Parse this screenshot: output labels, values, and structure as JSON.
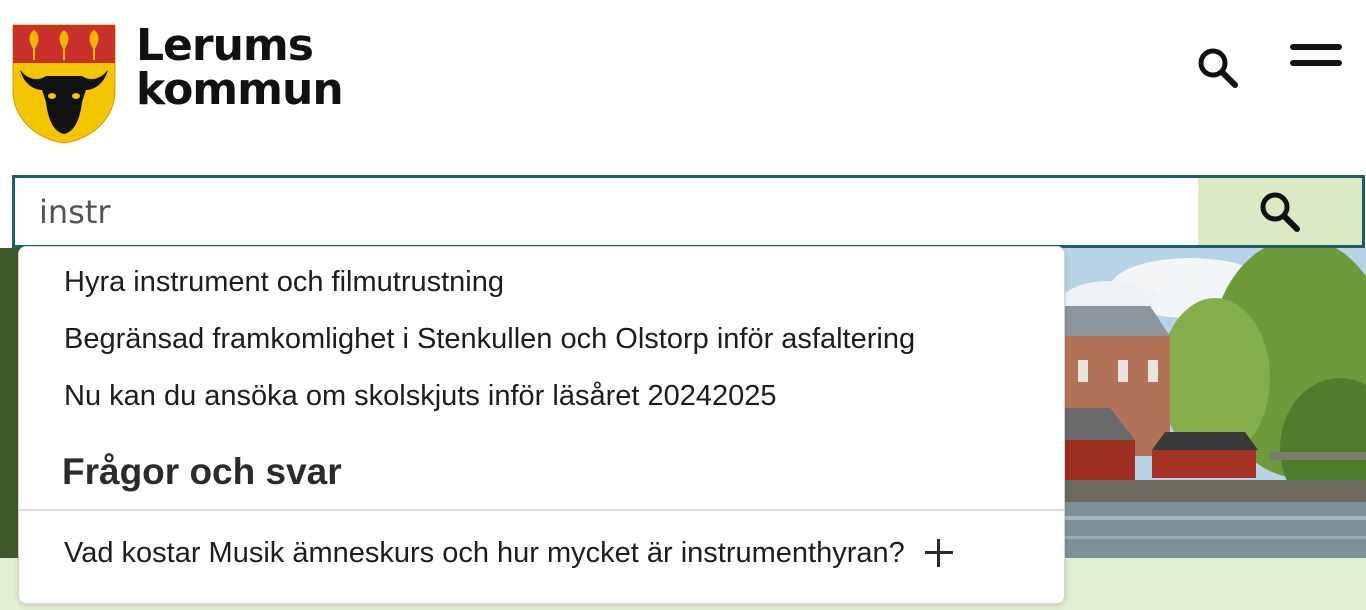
{
  "header": {
    "logo_line1": "Lerums",
    "logo_line2": "kommun",
    "crest_icon": "coat-of-arms-icon",
    "search_icon": "search-icon",
    "menu_icon": "hamburger-menu-icon"
  },
  "search": {
    "value": "instr",
    "submit_icon": "search-icon"
  },
  "suggestions": {
    "items": [
      "Hyra instrument och filmutrustning",
      "Begränsad framkomlighet i Stenkullen och Olstorp inför asfaltering",
      "Nu kan du ansöka om skolskjuts inför läsåret 20242025"
    ],
    "faq_heading": "Frågor och svar",
    "faq_items": [
      "Vad kostar Musik ämneskurs och hur mycket är instrumenthyran?"
    ]
  },
  "colors": {
    "search_border": "#1f5f62",
    "search_button_bg": "#dbe9c4",
    "crest_red": "#c9302c",
    "crest_yellow": "#f2c500",
    "crest_leaf": "#f0b400"
  }
}
